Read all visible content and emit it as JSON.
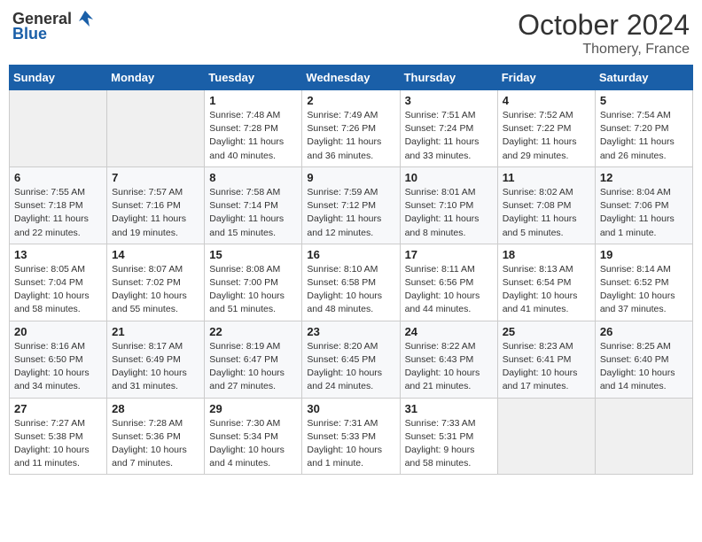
{
  "header": {
    "logo_general": "General",
    "logo_blue": "Blue",
    "month": "October 2024",
    "location": "Thomery, France"
  },
  "weekdays": [
    "Sunday",
    "Monday",
    "Tuesday",
    "Wednesday",
    "Thursday",
    "Friday",
    "Saturday"
  ],
  "weeks": [
    [
      {
        "day": "",
        "sunrise": "",
        "sunset": "",
        "daylight": ""
      },
      {
        "day": "",
        "sunrise": "",
        "sunset": "",
        "daylight": ""
      },
      {
        "day": "1",
        "sunrise": "Sunrise: 7:48 AM",
        "sunset": "Sunset: 7:28 PM",
        "daylight": "Daylight: 11 hours and 40 minutes."
      },
      {
        "day": "2",
        "sunrise": "Sunrise: 7:49 AM",
        "sunset": "Sunset: 7:26 PM",
        "daylight": "Daylight: 11 hours and 36 minutes."
      },
      {
        "day": "3",
        "sunrise": "Sunrise: 7:51 AM",
        "sunset": "Sunset: 7:24 PM",
        "daylight": "Daylight: 11 hours and 33 minutes."
      },
      {
        "day": "4",
        "sunrise": "Sunrise: 7:52 AM",
        "sunset": "Sunset: 7:22 PM",
        "daylight": "Daylight: 11 hours and 29 minutes."
      },
      {
        "day": "5",
        "sunrise": "Sunrise: 7:54 AM",
        "sunset": "Sunset: 7:20 PM",
        "daylight": "Daylight: 11 hours and 26 minutes."
      }
    ],
    [
      {
        "day": "6",
        "sunrise": "Sunrise: 7:55 AM",
        "sunset": "Sunset: 7:18 PM",
        "daylight": "Daylight: 11 hours and 22 minutes."
      },
      {
        "day": "7",
        "sunrise": "Sunrise: 7:57 AM",
        "sunset": "Sunset: 7:16 PM",
        "daylight": "Daylight: 11 hours and 19 minutes."
      },
      {
        "day": "8",
        "sunrise": "Sunrise: 7:58 AM",
        "sunset": "Sunset: 7:14 PM",
        "daylight": "Daylight: 11 hours and 15 minutes."
      },
      {
        "day": "9",
        "sunrise": "Sunrise: 7:59 AM",
        "sunset": "Sunset: 7:12 PM",
        "daylight": "Daylight: 11 hours and 12 minutes."
      },
      {
        "day": "10",
        "sunrise": "Sunrise: 8:01 AM",
        "sunset": "Sunset: 7:10 PM",
        "daylight": "Daylight: 11 hours and 8 minutes."
      },
      {
        "day": "11",
        "sunrise": "Sunrise: 8:02 AM",
        "sunset": "Sunset: 7:08 PM",
        "daylight": "Daylight: 11 hours and 5 minutes."
      },
      {
        "day": "12",
        "sunrise": "Sunrise: 8:04 AM",
        "sunset": "Sunset: 7:06 PM",
        "daylight": "Daylight: 11 hours and 1 minute."
      }
    ],
    [
      {
        "day": "13",
        "sunrise": "Sunrise: 8:05 AM",
        "sunset": "Sunset: 7:04 PM",
        "daylight": "Daylight: 10 hours and 58 minutes."
      },
      {
        "day": "14",
        "sunrise": "Sunrise: 8:07 AM",
        "sunset": "Sunset: 7:02 PM",
        "daylight": "Daylight: 10 hours and 55 minutes."
      },
      {
        "day": "15",
        "sunrise": "Sunrise: 8:08 AM",
        "sunset": "Sunset: 7:00 PM",
        "daylight": "Daylight: 10 hours and 51 minutes."
      },
      {
        "day": "16",
        "sunrise": "Sunrise: 8:10 AM",
        "sunset": "Sunset: 6:58 PM",
        "daylight": "Daylight: 10 hours and 48 minutes."
      },
      {
        "day": "17",
        "sunrise": "Sunrise: 8:11 AM",
        "sunset": "Sunset: 6:56 PM",
        "daylight": "Daylight: 10 hours and 44 minutes."
      },
      {
        "day": "18",
        "sunrise": "Sunrise: 8:13 AM",
        "sunset": "Sunset: 6:54 PM",
        "daylight": "Daylight: 10 hours and 41 minutes."
      },
      {
        "day": "19",
        "sunrise": "Sunrise: 8:14 AM",
        "sunset": "Sunset: 6:52 PM",
        "daylight": "Daylight: 10 hours and 37 minutes."
      }
    ],
    [
      {
        "day": "20",
        "sunrise": "Sunrise: 8:16 AM",
        "sunset": "Sunset: 6:50 PM",
        "daylight": "Daylight: 10 hours and 34 minutes."
      },
      {
        "day": "21",
        "sunrise": "Sunrise: 8:17 AM",
        "sunset": "Sunset: 6:49 PM",
        "daylight": "Daylight: 10 hours and 31 minutes."
      },
      {
        "day": "22",
        "sunrise": "Sunrise: 8:19 AM",
        "sunset": "Sunset: 6:47 PM",
        "daylight": "Daylight: 10 hours and 27 minutes."
      },
      {
        "day": "23",
        "sunrise": "Sunrise: 8:20 AM",
        "sunset": "Sunset: 6:45 PM",
        "daylight": "Daylight: 10 hours and 24 minutes."
      },
      {
        "day": "24",
        "sunrise": "Sunrise: 8:22 AM",
        "sunset": "Sunset: 6:43 PM",
        "daylight": "Daylight: 10 hours and 21 minutes."
      },
      {
        "day": "25",
        "sunrise": "Sunrise: 8:23 AM",
        "sunset": "Sunset: 6:41 PM",
        "daylight": "Daylight: 10 hours and 17 minutes."
      },
      {
        "day": "26",
        "sunrise": "Sunrise: 8:25 AM",
        "sunset": "Sunset: 6:40 PM",
        "daylight": "Daylight: 10 hours and 14 minutes."
      }
    ],
    [
      {
        "day": "27",
        "sunrise": "Sunrise: 7:27 AM",
        "sunset": "Sunset: 5:38 PM",
        "daylight": "Daylight: 10 hours and 11 minutes."
      },
      {
        "day": "28",
        "sunrise": "Sunrise: 7:28 AM",
        "sunset": "Sunset: 5:36 PM",
        "daylight": "Daylight: 10 hours and 7 minutes."
      },
      {
        "day": "29",
        "sunrise": "Sunrise: 7:30 AM",
        "sunset": "Sunset: 5:34 PM",
        "daylight": "Daylight: 10 hours and 4 minutes."
      },
      {
        "day": "30",
        "sunrise": "Sunrise: 7:31 AM",
        "sunset": "Sunset: 5:33 PM",
        "daylight": "Daylight: 10 hours and 1 minute."
      },
      {
        "day": "31",
        "sunrise": "Sunrise: 7:33 AM",
        "sunset": "Sunset: 5:31 PM",
        "daylight": "Daylight: 9 hours and 58 minutes."
      },
      {
        "day": "",
        "sunrise": "",
        "sunset": "",
        "daylight": ""
      },
      {
        "day": "",
        "sunrise": "",
        "sunset": "",
        "daylight": ""
      }
    ]
  ]
}
